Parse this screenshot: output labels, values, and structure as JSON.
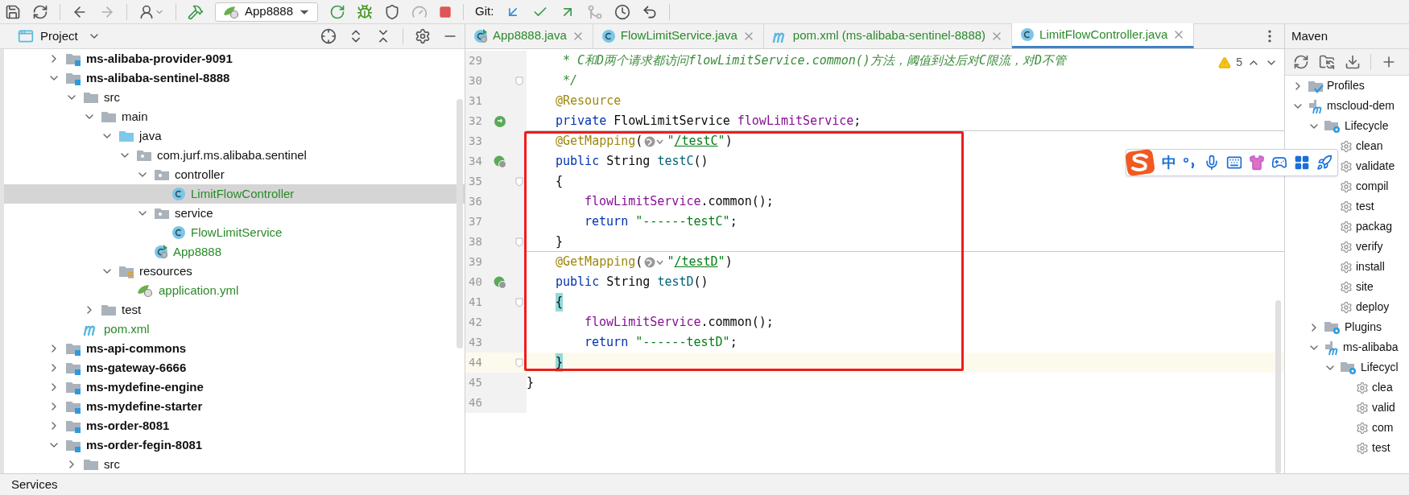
{
  "toolbar": {
    "nav": [
      {
        "kind": "back",
        "disabled": false
      },
      {
        "kind": "forward",
        "disabled": true
      }
    ],
    "run_config": "App8888",
    "run_actions": [
      {
        "kind": "rerun",
        "disabled": false
      },
      {
        "kind": "debug",
        "disabled": false
      },
      {
        "kind": "coverage",
        "disabled": false
      },
      {
        "kind": "profile",
        "disabled": true
      },
      {
        "kind": "stop",
        "disabled": false
      }
    ],
    "git_label": "Git:",
    "git_actions": [
      {
        "kind": "update",
        "disabled": false
      },
      {
        "kind": "commit",
        "disabled": false
      },
      {
        "kind": "push",
        "disabled": false
      },
      {
        "kind": "merge",
        "disabled": true
      },
      {
        "kind": "history",
        "disabled": false
      },
      {
        "kind": "rollback",
        "disabled": false
      }
    ]
  },
  "project_panel": {
    "title": "Project",
    "tree": [
      {
        "label": "ms-alibaba-provider-9091",
        "kind": "module",
        "expanded": false,
        "selected": false,
        "added": false
      },
      {
        "label": "ms-alibaba-sentinel-8888",
        "kind": "module",
        "expanded": true,
        "selected": false,
        "added": false,
        "children": [
          {
            "label": "src",
            "kind": "folder",
            "expanded": true,
            "selected": false,
            "added": false,
            "children": [
              {
                "label": "main",
                "kind": "folder",
                "expanded": true,
                "selected": false,
                "added": false,
                "children": [
                  {
                    "label": "java",
                    "kind": "source-root",
                    "expanded": true,
                    "selected": false,
                    "added": false,
                    "children": [
                      {
                        "label": "com.jurf.ms.alibaba.sentinel",
                        "kind": "package",
                        "expanded": true,
                        "selected": false,
                        "added": false,
                        "children": [
                          {
                            "label": "controller",
                            "kind": "package",
                            "expanded": true,
                            "selected": false,
                            "added": false,
                            "children": [
                              {
                                "label": "LimitFlowController",
                                "kind": "class",
                                "selected": true,
                                "added": true
                              }
                            ]
                          },
                          {
                            "label": "service",
                            "kind": "package",
                            "expanded": true,
                            "selected": false,
                            "added": false,
                            "children": [
                              {
                                "label": "FlowLimitService",
                                "kind": "class",
                                "selected": false,
                                "added": true
                              }
                            ]
                          },
                          {
                            "label": "App8888",
                            "kind": "app",
                            "selected": false,
                            "added": true
                          }
                        ]
                      }
                    ]
                  },
                  {
                    "label": "resources",
                    "kind": "resources",
                    "expanded": true,
                    "selected": false,
                    "added": false,
                    "children": [
                      {
                        "label": "application.yml",
                        "kind": "yml",
                        "selected": false,
                        "added": true
                      }
                    ]
                  }
                ]
              },
              {
                "label": "test",
                "kind": "folder",
                "expanded": false,
                "selected": false,
                "added": false
              }
            ]
          },
          {
            "label": "pom.xml",
            "kind": "pom",
            "selected": false,
            "added": true
          }
        ]
      },
      {
        "label": "ms-api-commons",
        "kind": "module",
        "expanded": false,
        "selected": false,
        "added": false
      },
      {
        "label": "ms-gateway-6666",
        "kind": "module",
        "expanded": false,
        "selected": false,
        "added": false
      },
      {
        "label": "ms-mydefine-engine",
        "kind": "module",
        "expanded": false,
        "selected": false,
        "added": false
      },
      {
        "label": "ms-mydefine-starter",
        "kind": "module",
        "expanded": false,
        "selected": false,
        "added": false
      },
      {
        "label": "ms-order-8081",
        "kind": "module",
        "expanded": false,
        "selected": false,
        "added": false
      },
      {
        "label": "ms-order-fegin-8081",
        "kind": "module",
        "expanded": true,
        "selected": false,
        "added": false,
        "children": [
          {
            "label": "src",
            "kind": "folder",
            "expanded": false,
            "selected": false,
            "added": false
          }
        ]
      }
    ]
  },
  "tabs": [
    {
      "label": "App8888.java",
      "kind": "app",
      "selected": false,
      "added": true
    },
    {
      "label": "FlowLimitService.java",
      "kind": "class",
      "selected": false,
      "added": true
    },
    {
      "label": "pom.xml (ms-alibaba-sentinel-8888)",
      "kind": "pom",
      "selected": false,
      "added": true
    },
    {
      "label": "LimitFlowController.java",
      "kind": "class",
      "selected": true,
      "added": true
    }
  ],
  "editor": {
    "warnings": "5",
    "blocks": [
      {
        "boxed": false,
        "lines": [
          {
            "number": "29",
            "kind": "doc",
            "fold": false,
            "current": false,
            "separator": false,
            "tokens": [
              {
                "kind": "comment",
                "text": "* C和D两个请求都访问flowLimitService.common()方法，阈值到达后对C限流，对D不管"
              }
            ]
          },
          {
            "number": "30",
            "kind": "doc",
            "fold": true,
            "current": false,
            "separator": false,
            "tokens": [
              {
                "kind": "comment",
                "text": "*/"
              }
            ]
          },
          {
            "number": "31",
            "kind": "member",
            "fold": false,
            "current": false,
            "separator": false,
            "tokens": [
              {
                "kind": "annotation",
                "text": "@Resource"
              }
            ]
          },
          {
            "number": "32",
            "kind": "member",
            "gutter": {
              "kind": "bean"
            },
            "fold": false,
            "current": false,
            "separator": true,
            "tokens": [
              {
                "kind": "keyword",
                "text": "private"
              },
              {
                "kind": "plain",
                "text": " FlowLimitService "
              },
              {
                "kind": "field",
                "text": "flowLimitService"
              },
              {
                "kind": "plain",
                "text": ";"
              }
            ]
          }
        ]
      },
      {
        "boxed": true,
        "lines": [
          {
            "number": "33",
            "kind": "member",
            "fold": false,
            "current": false,
            "separator": false,
            "tokens": [
              {
                "kind": "annotation",
                "text": "@GetMapping"
              },
              {
                "kind": "plain",
                "text": "("
              },
              {
                "kind": "inlay"
              },
              {
                "kind": "string",
                "text": "\""
              },
              {
                "kind": "url",
                "text": "/testC"
              },
              {
                "kind": "string",
                "text": "\""
              },
              {
                "kind": "plain",
                "text": ")"
              }
            ]
          },
          {
            "number": "34",
            "kind": "member",
            "gutter": {
              "kind": "web"
            },
            "fold": false,
            "current": false,
            "separator": false,
            "tokens": [
              {
                "kind": "keyword",
                "text": "public"
              },
              {
                "kind": "plain",
                "text": " String "
              },
              {
                "kind": "method",
                "text": "testC"
              },
              {
                "kind": "plain",
                "text": "()"
              }
            ]
          },
          {
            "number": "35",
            "kind": "member",
            "fold": true,
            "current": false,
            "separator": false,
            "tokens": [
              {
                "kind": "plain",
                "text": "{"
              }
            ]
          },
          {
            "number": "36",
            "kind": "body",
            "fold": false,
            "current": false,
            "separator": false,
            "tokens": [
              {
                "kind": "field",
                "text": "flowLimitService"
              },
              {
                "kind": "plain",
                "text": ".common();"
              }
            ]
          },
          {
            "number": "37",
            "kind": "body",
            "fold": false,
            "current": false,
            "separator": false,
            "tokens": [
              {
                "kind": "keyword",
                "text": "return "
              },
              {
                "kind": "string",
                "text": "\"------testC\""
              },
              {
                "kind": "plain",
                "text": ";"
              }
            ]
          },
          {
            "number": "38",
            "kind": "member",
            "fold": true,
            "current": false,
            "separator": true,
            "tokens": [
              {
                "kind": "plain",
                "text": "}"
              }
            ]
          },
          {
            "number": "39",
            "kind": "member",
            "fold": false,
            "current": false,
            "separator": false,
            "tokens": [
              {
                "kind": "annotation",
                "text": "@GetMapping"
              },
              {
                "kind": "plain",
                "text": "("
              },
              {
                "kind": "inlay"
              },
              {
                "kind": "string",
                "text": "\""
              },
              {
                "kind": "url",
                "text": "/testD"
              },
              {
                "kind": "string",
                "text": "\""
              },
              {
                "kind": "plain",
                "text": ")"
              }
            ]
          },
          {
            "number": "40",
            "kind": "member",
            "gutter": {
              "kind": "web"
            },
            "fold": false,
            "current": false,
            "separator": false,
            "tokens": [
              {
                "kind": "keyword",
                "text": "public"
              },
              {
                "kind": "plain",
                "text": " String "
              },
              {
                "kind": "method",
                "text": "testD"
              },
              {
                "kind": "plain",
                "text": "()"
              }
            ]
          },
          {
            "number": "41",
            "kind": "member",
            "fold": true,
            "current": false,
            "separator": false,
            "tokens": [
              {
                "kind": "brace",
                "text": "{"
              }
            ]
          },
          {
            "number": "42",
            "kind": "body",
            "fold": false,
            "current": false,
            "separator": false,
            "tokens": [
              {
                "kind": "field",
                "text": "flowLimitService"
              },
              {
                "kind": "plain",
                "text": ".common();"
              }
            ]
          },
          {
            "number": "43",
            "kind": "body",
            "fold": false,
            "current": false,
            "separator": false,
            "tokens": [
              {
                "kind": "keyword",
                "text": "return "
              },
              {
                "kind": "string",
                "text": "\"------testD\""
              },
              {
                "kind": "plain",
                "text": ";"
              }
            ]
          },
          {
            "number": "44",
            "kind": "member",
            "fold": true,
            "current": true,
            "separator": false,
            "tokens": [
              {
                "kind": "brace",
                "text": "}"
              }
            ]
          }
        ]
      },
      {
        "boxed": false,
        "lines": [
          {
            "number": "45",
            "kind": "top",
            "fold": false,
            "current": false,
            "separator": false,
            "tokens": [
              {
                "kind": "plain",
                "text": "}"
              }
            ]
          },
          {
            "number": "46",
            "kind": "top",
            "fold": false,
            "current": false,
            "separator": false
          }
        ]
      }
    ]
  },
  "maven_panel": {
    "title": "Maven",
    "tree": [
      {
        "label": "Profiles",
        "kind": "profiles",
        "expanded": false
      },
      {
        "label": "mscloud-dem",
        "kind": "project",
        "expanded": true,
        "children": [
          {
            "label": "Lifecycle",
            "kind": "lifecycle",
            "expanded": true,
            "children": [
              {
                "label": "clean",
                "kind": "goal"
              },
              {
                "label": "validate",
                "kind": "goal"
              },
              {
                "label": "compil",
                "kind": "goal"
              },
              {
                "label": "test",
                "kind": "goal"
              },
              {
                "label": "packag",
                "kind": "goal"
              },
              {
                "label": "verify",
                "kind": "goal"
              },
              {
                "label": "install",
                "kind": "goal"
              },
              {
                "label": "site",
                "kind": "goal"
              },
              {
                "label": "deploy",
                "kind": "goal"
              }
            ]
          },
          {
            "label": "Plugins",
            "kind": "lifecycle",
            "expanded": false
          },
          {
            "label": "ms-alibaba",
            "kind": "project",
            "expanded": true,
            "children": [
              {
                "label": "Lifecycl",
                "kind": "lifecycle",
                "expanded": true,
                "children": [
                  {
                    "label": "clea",
                    "kind": "goal"
                  },
                  {
                    "label": "valid",
                    "kind": "goal"
                  },
                  {
                    "label": "com",
                    "kind": "goal"
                  },
                  {
                    "label": "test",
                    "kind": "goal"
                  }
                ]
              }
            ]
          }
        ]
      }
    ]
  },
  "ime_toolbar": {
    "mode": "中"
  },
  "status_bar": {
    "label": "Services"
  }
}
